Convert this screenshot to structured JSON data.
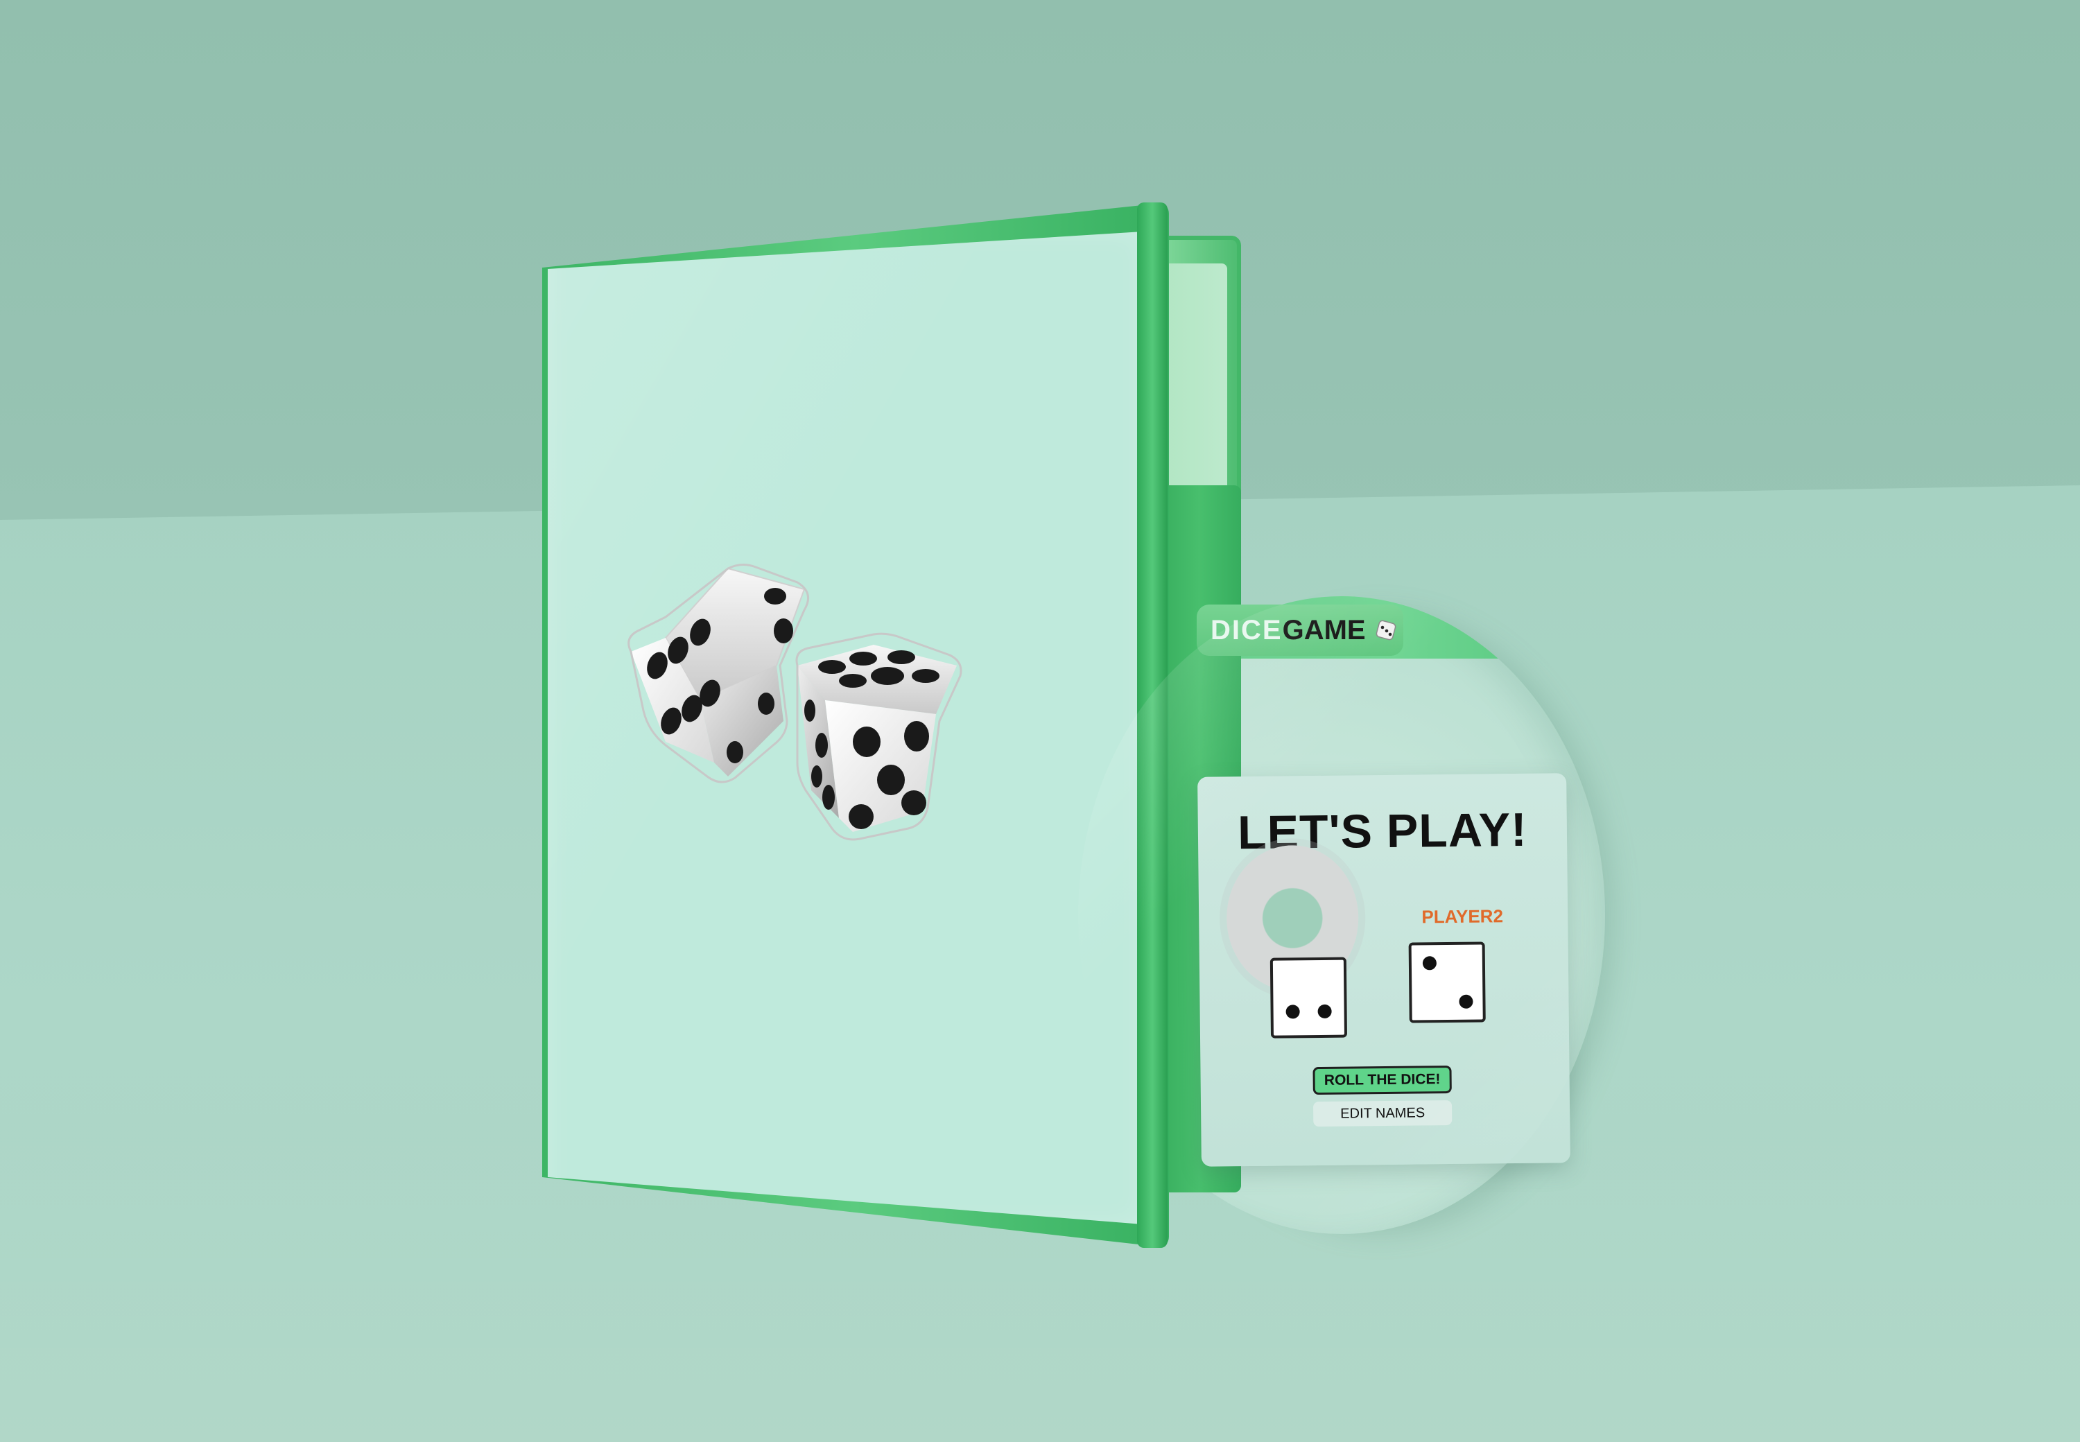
{
  "disc": {
    "title_part1": "DICE",
    "title_part2": "GAME",
    "title_icon": "die-icon"
  },
  "game_screen": {
    "heading": "LET'S PLAY!",
    "player2_name": "PLAYER2",
    "player1_die_value": 2,
    "player2_die_value": 2,
    "roll_button_label": "ROLL THE DICE!",
    "edit_button_label": "EDIT NAMES"
  },
  "colors": {
    "background": "#96c1b1",
    "case_green": "#3db565",
    "accent_green": "#5fd48a",
    "player2_orange": "#e06a2a"
  }
}
